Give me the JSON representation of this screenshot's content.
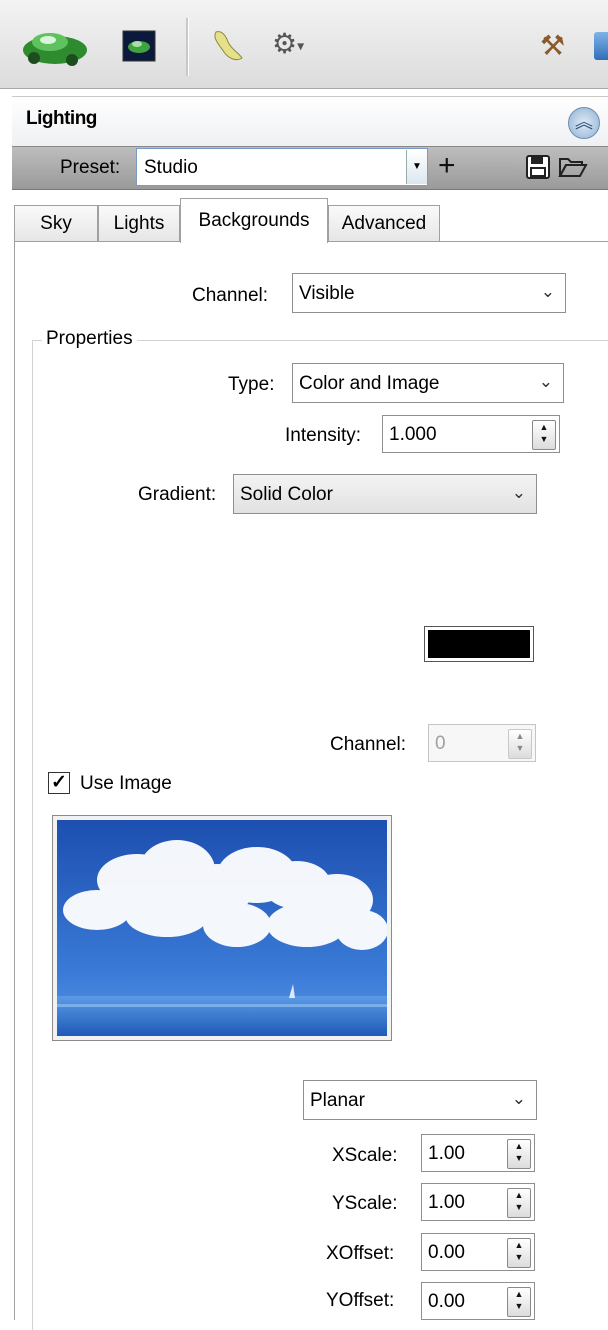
{
  "toolbar": {
    "icons": [
      "car-render-icon",
      "screen-render-icon",
      "footprint-icon",
      "gear-dropdown-icon",
      "tools-icon",
      "help-icon"
    ]
  },
  "panel": {
    "title": "Lighting",
    "preset_label": "Preset:",
    "preset_value": "Studio"
  },
  "tabs": [
    {
      "label": "Sky"
    },
    {
      "label": "Lights"
    },
    {
      "label": "Backgrounds"
    },
    {
      "label": "Advanced"
    }
  ],
  "backgrounds": {
    "channel_label": "Channel:",
    "channel_value": "Visible",
    "properties_title": "Properties",
    "type_label": "Type:",
    "type_value": "Color and Image",
    "intensity_label": "Intensity:",
    "intensity_value": "1.000",
    "gradient_label": "Gradient:",
    "gradient_value": "Solid Color",
    "color": "#000000",
    "color_channel_label": "Channel:",
    "color_channel_value": "0",
    "use_image_label": "Use Image",
    "use_image_checked": true,
    "projection_value": "Planar",
    "xscale_label": "XScale:",
    "xscale_value": "1.00",
    "yscale_label": "YScale:",
    "yscale_value": "1.00",
    "xoffset_label": "XOffset:",
    "xoffset_value": "0.00",
    "yoffset_label": "YOffset:",
    "yoffset_value": "0.00"
  }
}
